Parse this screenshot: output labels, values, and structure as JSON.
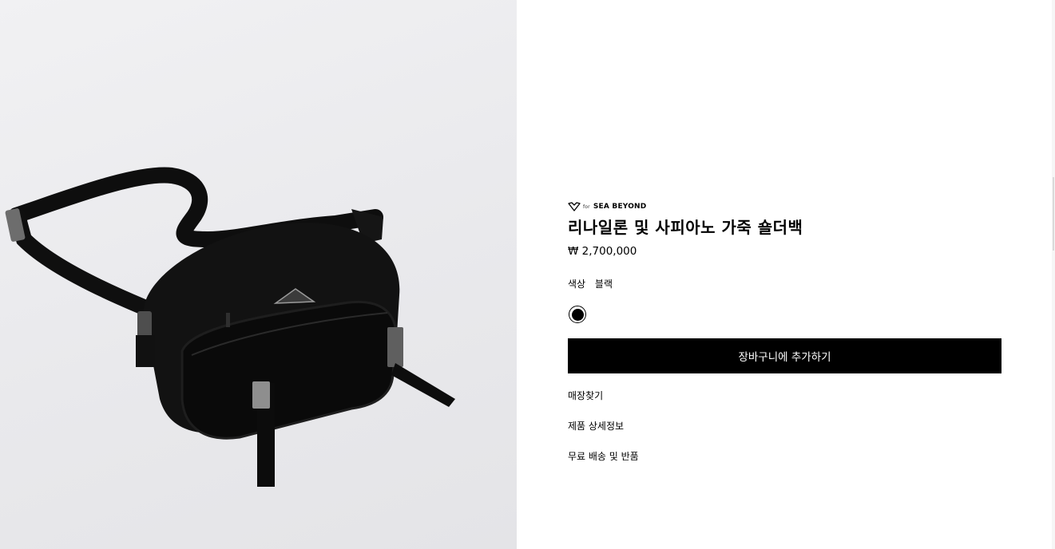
{
  "product_image": {
    "alt": "",
    "icon": "black-nylon-shoulder-bag-image"
  },
  "product": {
    "brand_prefix": "for",
    "brand": "SEA BEYOND",
    "title": "리나일론 및 사피아노 가죽 숄더백",
    "price": "₩ 2,700,000",
    "color_label": "색상",
    "color_value": "블랙",
    "swatch_color": "#000000"
  },
  "actions": {
    "add_to_cart": "장바구니에 추가하기"
  },
  "links": {
    "store_finder": "매장찾기",
    "product_details": "제품 상세정보",
    "shipping_returns": "무료 배송 및 반품"
  },
  "colors": {
    "accent": "#000000",
    "button_text": "#ffffff",
    "image_background": "#ebebee"
  }
}
